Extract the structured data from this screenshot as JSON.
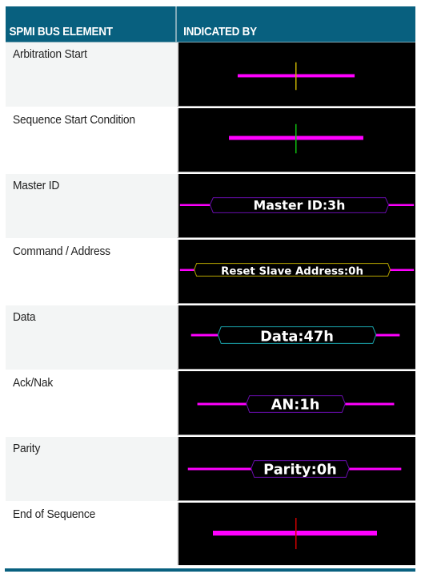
{
  "table": {
    "headers": [
      "SPMI BUS ELEMENT",
      "INDICATED BY"
    ],
    "rows": [
      {
        "label": "Arbitration Start",
        "indicator": {
          "kind": "marker",
          "marker_color": "#c8b400"
        }
      },
      {
        "label": "Sequence Start Condition",
        "indicator": {
          "kind": "marker",
          "marker_color": "#10c010"
        }
      },
      {
        "label": "Master ID",
        "indicator": {
          "kind": "packet",
          "text": "Master ID:3h",
          "outline_color": "#6a0dad"
        }
      },
      {
        "label": "Command / Address",
        "indicator": {
          "kind": "packet",
          "text": "Reset Slave Address:0h",
          "outline_color": "#b5a400"
        }
      },
      {
        "label": "Data",
        "indicator": {
          "kind": "packet",
          "text": "Data:47h",
          "outline_color": "#1aa0a8"
        }
      },
      {
        "label": "Ack/Nak",
        "indicator": {
          "kind": "packet",
          "text": "AN:1h",
          "outline_color": "#6a0dad"
        }
      },
      {
        "label": "Parity",
        "indicator": {
          "kind": "packet",
          "text": "Parity:0h",
          "outline_color": "#6a0dad"
        }
      },
      {
        "label": "End of Sequence",
        "indicator": {
          "kind": "marker",
          "marker_color": "#d00000"
        }
      }
    ]
  },
  "colors": {
    "header_bg": "#08607f",
    "bus_line": "#ff00ff",
    "viz_bg": "#000000"
  }
}
